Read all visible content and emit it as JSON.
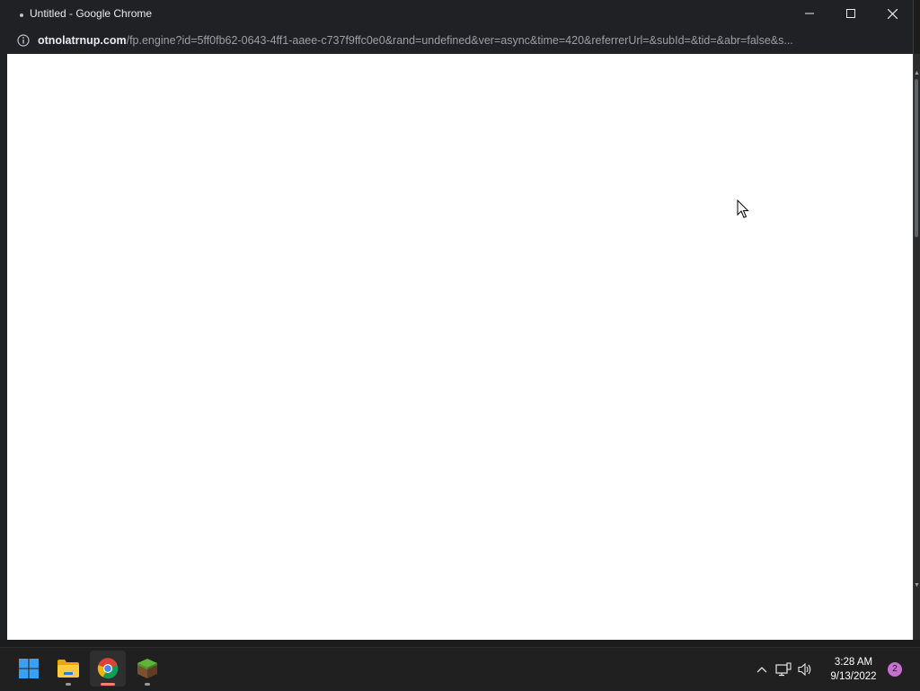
{
  "window": {
    "title": "Untitled - Google Chrome"
  },
  "address_bar": {
    "domain": "otnolatrnup.com",
    "path": "/fp.engine?id=5ff0fb62-0643-4ff1-aaee-c737f9ffc0e0&rand=undefined&ver=async&time=420&referrerUrl=&subId=&tid=&abr=false&s..."
  },
  "taskbar": {
    "apps": [
      {
        "name": "start",
        "icon": "windows-logo-icon"
      },
      {
        "name": "file-explorer",
        "icon": "folder-icon"
      },
      {
        "name": "chrome",
        "icon": "chrome-icon"
      },
      {
        "name": "minecraft",
        "icon": "grass-block-icon"
      }
    ],
    "clock": {
      "time": "3:28 AM",
      "date": "9/13/2022"
    },
    "notification_count": "2"
  },
  "colors": {
    "accent": "#0078d4",
    "titlebar": "#202124",
    "content": "#ffffff",
    "taskbar": "#202020",
    "badge": "#c56fd0"
  }
}
